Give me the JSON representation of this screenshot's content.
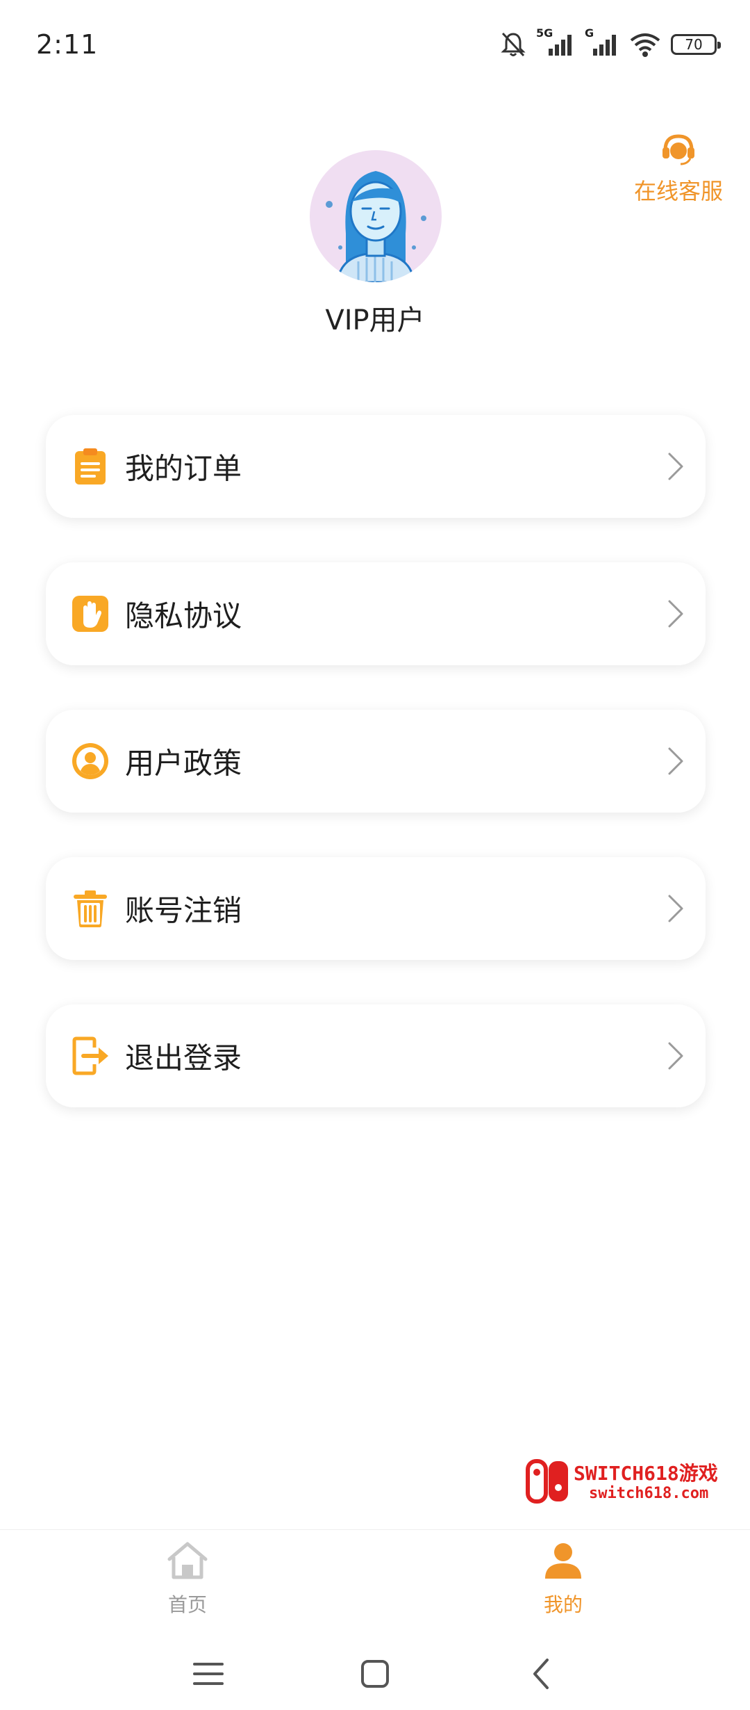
{
  "status_bar": {
    "time": "2:11",
    "network_1": "5G",
    "network_2": "G",
    "battery": "70"
  },
  "header": {
    "service_icon": "headset-icon",
    "service_label": "在线客服"
  },
  "profile": {
    "avatar_icon": "user-avatar-illustration",
    "username": "VIP用户"
  },
  "menu": {
    "items": [
      {
        "icon": "clipboard-icon",
        "label": "我的订单"
      },
      {
        "icon": "hand-icon",
        "label": "隐私协议"
      },
      {
        "icon": "user-circle-icon",
        "label": "用户政策"
      },
      {
        "icon": "trash-icon",
        "label": "账号注销"
      },
      {
        "icon": "logout-icon",
        "label": "退出登录"
      }
    ]
  },
  "watermark": {
    "title": "SWITCH618游戏",
    "url": "switch618.com"
  },
  "bottom_nav": {
    "items": [
      {
        "icon": "home-icon",
        "label": "首页",
        "active": false
      },
      {
        "icon": "person-icon",
        "label": "我的",
        "active": true
      }
    ]
  },
  "colors": {
    "accent": "#f0952a",
    "icon_orange": "#f9a825",
    "inactive": "#9a9a9a",
    "avatar_bg": "#f0def2",
    "watermark_red": "#e02020"
  }
}
